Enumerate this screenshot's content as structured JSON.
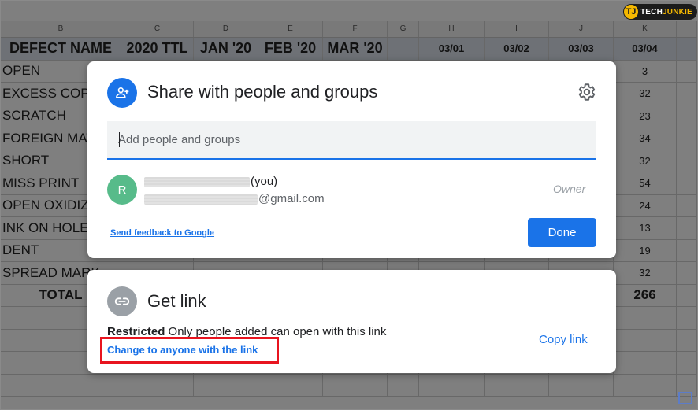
{
  "logo": {
    "prefix": "TECH",
    "suffix": "JUNKIE"
  },
  "sheet": {
    "columns": [
      "B",
      "C",
      "D",
      "E",
      "F",
      "G",
      "H",
      "I",
      "J",
      "K"
    ],
    "header": [
      "DEFECT NAME",
      "2020 TTL",
      "JAN '20",
      "FEB '20",
      "MAR '20",
      "",
      "03/01",
      "03/02",
      "03/03",
      "03/04"
    ],
    "rows": [
      {
        "name": "OPEN",
        "k": "3"
      },
      {
        "name": "EXCESS COPPE",
        "k": "32"
      },
      {
        "name": "SCRATCH",
        "k": "23"
      },
      {
        "name": "FOREIGN MAT",
        "k": "34"
      },
      {
        "name": "SHORT",
        "k": "32"
      },
      {
        "name": "MISS PRINT",
        "k": "54"
      },
      {
        "name": "OPEN OXIDIZE",
        "k": "24"
      },
      {
        "name": "INK ON HOLE",
        "k": "13"
      },
      {
        "name": "DENT",
        "k": "19"
      },
      {
        "name": "SPREAD MARK",
        "k": "32"
      }
    ],
    "total_label": "TOTAL",
    "total_value": "266"
  },
  "share_dialog": {
    "title": "Share with people and groups",
    "input_placeholder": "Add people and groups",
    "user": {
      "initial": "R",
      "you_label": "(you)",
      "email_suffix": "@gmail.com",
      "role": "Owner"
    },
    "feedback_link": "Send feedback to Google",
    "done_button": "Done"
  },
  "link_dialog": {
    "title": "Get link",
    "restriction_label": "Restricted",
    "restriction_desc": " Only people added can open with this link",
    "change_link": "Change to anyone with the link",
    "copy_link": "Copy link"
  },
  "colors": {
    "accent": "#1a73e8",
    "highlight": "#e8141f",
    "avatar": "#57bb8a"
  }
}
